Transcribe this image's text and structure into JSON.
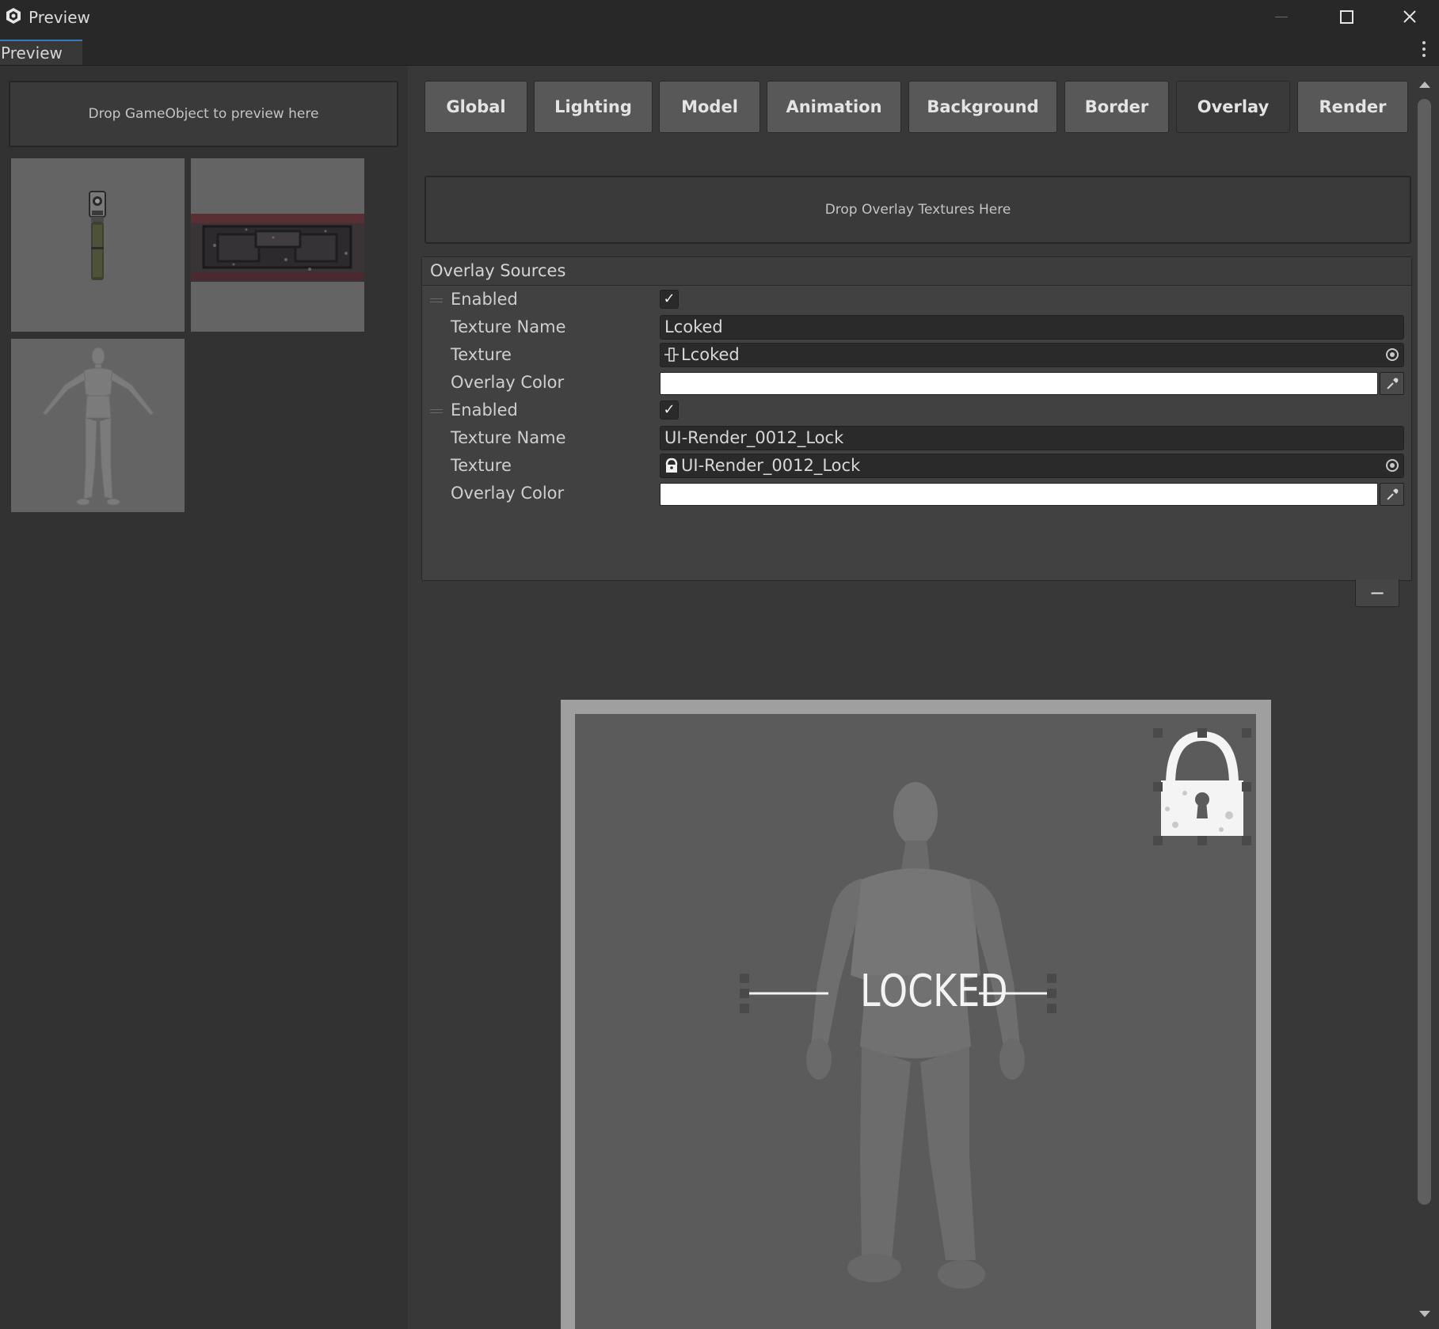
{
  "window": {
    "title": "Preview",
    "tab_label": "Preview"
  },
  "left": {
    "drop_gameobject": "Drop GameObject to preview here",
    "thumbnails": [
      "pistol",
      "weapon case",
      "humanoid figure"
    ]
  },
  "tabs": [
    {
      "label": "Global",
      "active": false
    },
    {
      "label": "Lighting",
      "active": false
    },
    {
      "label": "Model",
      "active": false
    },
    {
      "label": "Animation",
      "active": false
    },
    {
      "label": "Background",
      "active": false
    },
    {
      "label": "Border",
      "active": false
    },
    {
      "label": "Overlay",
      "active": true
    },
    {
      "label": "Render",
      "active": false
    }
  ],
  "overlay": {
    "drop_textures": "Drop Overlay Textures Here",
    "sources_header": "Overlay Sources",
    "labels": {
      "enabled": "Enabled",
      "texture_name": "Texture Name",
      "texture": "Texture",
      "overlay_color": "Overlay Color"
    },
    "items": [
      {
        "enabled": true,
        "texture_name": "Lcoked",
        "texture": "Lcoked",
        "color": "#ffffff"
      },
      {
        "enabled": true,
        "texture_name": "UI-Render_0012_Lock",
        "texture": "UI-Render_0012_Lock",
        "color": "#ffffff"
      }
    ],
    "remove_label": "−"
  },
  "preview": {
    "overlay_text": "LOCKED"
  },
  "colors": {
    "accent": "#3a79bb",
    "background": "#383838",
    "frame": "#9f9f9f"
  }
}
